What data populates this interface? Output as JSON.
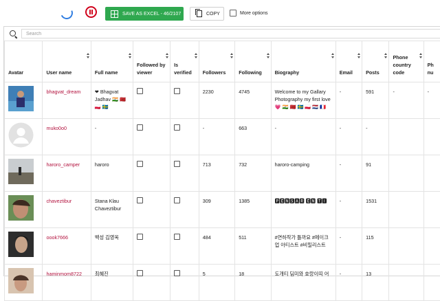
{
  "toolbar": {
    "excel_label": "SAVE AS EXCEL - 46/2107",
    "copy_label": "COPY",
    "more_label": "More options"
  },
  "search": {
    "placeholder": "Search"
  },
  "columns": [
    "Avatar",
    "User name",
    "Full name",
    "Followed by viewer",
    "Is verified",
    "Followers",
    "Following",
    "Biography",
    "Email",
    "Posts",
    "Phone country code",
    "Ph nu"
  ],
  "rows": [
    {
      "username": "bhagvat_dream",
      "fullname": "❤ Bhagvat Jadhav 🇮🇳 🇲🇦 🇵🇱 🇸🇪",
      "followers": "2230",
      "following": "4745",
      "bio": "Welcome to my Gallary Photography my first love 💗 🇮🇳 🇲🇦 🇸🇪 🇵🇱 🇳🇱 🇫🇷",
      "email": "-",
      "posts": "591",
      "phone_cc": "-",
      "phone_num": "-"
    },
    {
      "username": "muko0o0",
      "fullname": "-",
      "followers": "-",
      "following": "663",
      "bio": "-",
      "email": "-",
      "posts": "-",
      "phone_cc": "",
      "phone_num": ""
    },
    {
      "username": "haroro_camper",
      "fullname": "haroro",
      "followers": "713",
      "following": "732",
      "bio": "haroro-camping",
      "email": "-",
      "posts": "91",
      "phone_cc": "",
      "phone_num": ""
    },
    {
      "username": "chaveztibur",
      "fullname": "Stana Klau Chaveztibur",
      "followers": "309",
      "following": "1385",
      "bio": "🅿🅴🅽🆂🅰🆁 🅴🅽 🆃🅸",
      "email": "-",
      "posts": "1531",
      "phone_cc": "",
      "phone_num": ""
    },
    {
      "username": "oook7666",
      "fullname": "백성 김영옥",
      "followers": "484",
      "following": "511",
      "bio": "#연하작가 틀까요 #메이크업 아티스트 #비밀리스트",
      "email": "-",
      "posts": "115",
      "phone_cc": "",
      "phone_num": ""
    },
    {
      "username": "haminmom8722",
      "fullname": "최혜진",
      "followers": "5",
      "following": "18",
      "bio": "도개티 딤미와 호랑이띠 어",
      "email": "-",
      "posts": "13",
      "phone_cc": "",
      "phone_num": ""
    }
  ],
  "colors": {
    "accent_user": "#b3123e",
    "excel_green": "#2fa84f",
    "pause_red": "#d0021b",
    "spinner_blue": "#2f7de1"
  },
  "icons": [
    "loading-spinner-icon",
    "pause-icon",
    "excel-icon",
    "copy-icon",
    "checkbox-icon",
    "search-icon",
    "sort-icon"
  ]
}
